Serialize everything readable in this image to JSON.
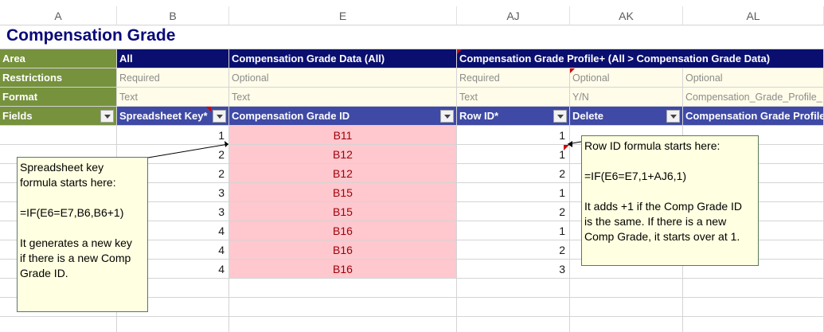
{
  "columns": [
    "A",
    "B",
    "E",
    "AJ",
    "AK",
    "AL"
  ],
  "title": "Compensation Grade",
  "rows": {
    "area": {
      "label": "Area",
      "values": [
        "All",
        "Compensation Grade Data (All)",
        "Compensation Grade Profile+ (All > Compensation Grade Data)"
      ]
    },
    "restrictions": {
      "label": "Restrictions",
      "values": [
        "Required",
        "Optional",
        "Required",
        "Optional",
        "Optional"
      ]
    },
    "format": {
      "label": "Format",
      "values": [
        "Text",
        "Text",
        "Text",
        "Y/N",
        "Compensation_Grade_Profile_"
      ]
    },
    "fields": {
      "label": "Fields",
      "values": [
        "Spreadsheet Key*",
        "Compensation Grade ID",
        "Row ID*",
        "Delete",
        "Compensation Grade Profile"
      ]
    }
  },
  "data_rows": [
    {
      "key": "1",
      "grade_id": "B11",
      "row_id": "1"
    },
    {
      "key": "2",
      "grade_id": "B12",
      "row_id": "1"
    },
    {
      "key": "2",
      "grade_id": "B12",
      "row_id": "2"
    },
    {
      "key": "3",
      "grade_id": "B15",
      "row_id": "1"
    },
    {
      "key": "3",
      "grade_id": "B15",
      "row_id": "2"
    },
    {
      "key": "4",
      "grade_id": "B16",
      "row_id": "1"
    },
    {
      "key": "4",
      "grade_id": "B16",
      "row_id": "2"
    },
    {
      "key": "4",
      "grade_id": "B16",
      "row_id": "3"
    }
  ],
  "notes": {
    "spreadsheet_key": "Spreadsheet key\nformula starts here:\n\n=IF(E6=E7,B6,B6+1)\n\nIt generates a new key\nif there is a new Comp\nGrade ID.",
    "row_id": "Row ID formula starts here:\n\n=IF(E6=E7,1+AJ6,1)\n\nIt adds +1 if the Comp Grade ID\nis the same. If there is a new\nComp Grade, it starts over at 1."
  },
  "colors": {
    "label_green": "#76923c",
    "header_navy": "#0a0f6f",
    "field_blue": "#3f4aa6",
    "grade_fill": "#ffc7ce",
    "grade_text": "#9c0006",
    "note_fill": "#ffffe1",
    "comment_marker": "#d00000"
  },
  "icons": [
    "filter-dropdown-icon",
    "comment-indicator-icon"
  ]
}
